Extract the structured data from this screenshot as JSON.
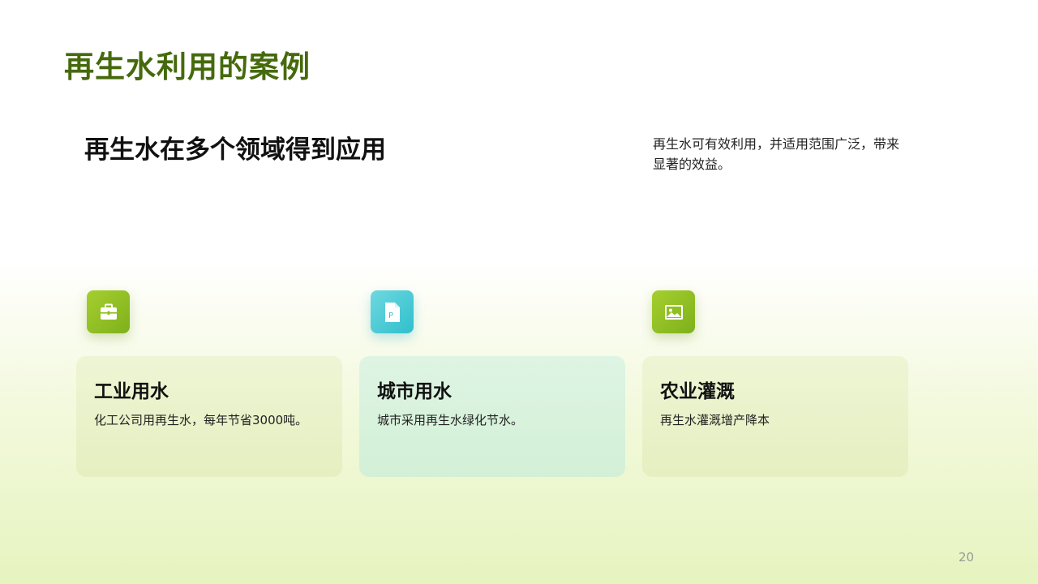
{
  "slide": {
    "title": "再生水利用的案例",
    "subtitle": "再生水在多个领域得到应用",
    "side_text": "再生水可有效利用，并适用范围广泛，带来显著的效益。",
    "page_number": "20"
  },
  "cards": [
    {
      "icon": "toolbox-icon",
      "title": "工业用水",
      "desc": "化工公司用再生水，每年节省3000吨。"
    },
    {
      "icon": "ppt-document-icon",
      "title": "城市用水",
      "desc": "城市采用再生水绿化节水。"
    },
    {
      "icon": "image-icon",
      "title": "农业灌溉",
      "desc": "再生水灌溉增产降本"
    }
  ],
  "colors": {
    "title": "#456a0c",
    "accent_green": "#8cbf22",
    "accent_teal": "#3cc4cf"
  }
}
